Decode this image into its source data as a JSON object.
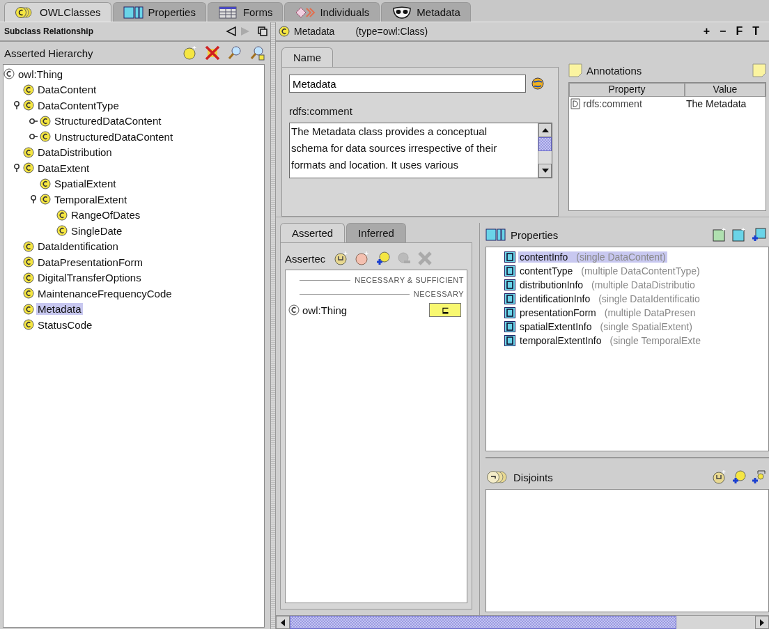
{
  "tabs": [
    {
      "label": "OWLClasses",
      "kind": "class",
      "selected": true
    },
    {
      "label": "Properties",
      "kind": "property",
      "selected": false
    },
    {
      "label": "Forms",
      "kind": "form",
      "selected": false
    },
    {
      "label": "Individuals",
      "kind": "individual",
      "selected": false
    },
    {
      "label": "Metadata",
      "kind": "metadata",
      "selected": false
    }
  ],
  "left": {
    "header": "Subclass Relationship",
    "title": "Asserted Hierarchy",
    "tree": [
      {
        "label": "owl:Thing",
        "selected": false,
        "children": [
          {
            "label": "DataContent",
            "selected": false
          },
          {
            "label": "DataContentType",
            "selected": false,
            "expanded": true,
            "children": [
              {
                "label": "StructuredDataContent",
                "selected": false,
                "expanded": false
              },
              {
                "label": "UnstructuredDataContent",
                "selected": false,
                "expanded": false
              }
            ]
          },
          {
            "label": "DataDistribution",
            "selected": false
          },
          {
            "label": "DataExtent",
            "selected": false,
            "expanded": true,
            "children": [
              {
                "label": "SpatialExtent",
                "selected": false
              },
              {
                "label": "TemporalExtent",
                "selected": false,
                "expanded": true,
                "children": [
                  {
                    "label": "RangeOfDates",
                    "selected": false
                  },
                  {
                    "label": "SingleDate",
                    "selected": false
                  }
                ]
              }
            ]
          },
          {
            "label": "DataIdentification",
            "selected": false
          },
          {
            "label": "DataPresentationForm",
            "selected": false
          },
          {
            "label": "DigitalTransferOptions",
            "selected": false
          },
          {
            "label": "MaintenanceFrequencyCode",
            "selected": false
          },
          {
            "label": "Metadata",
            "selected": true
          },
          {
            "label": "StatusCode",
            "selected": false
          }
        ]
      }
    ]
  },
  "class_header": {
    "name": "Metadata",
    "type": "(type=owl:Class)",
    "actions": [
      "+",
      "−",
      "F",
      "T"
    ]
  },
  "name_panel": {
    "tab": "Name",
    "value": "Metadata",
    "comment_label": "rdfs:comment",
    "comment": "The Metadata class provides a conceptual schema for data sources irrespective of their formats and location. It uses various"
  },
  "annotations": {
    "title": "Annotations",
    "columns": [
      "Property",
      "Value"
    ],
    "rows": [
      {
        "property": "rdfs:comment",
        "value": "The Metadata"
      }
    ]
  },
  "conditions": {
    "tabs": [
      {
        "label": "Asserted",
        "selected": true
      },
      {
        "label": "Inferred",
        "selected": false
      }
    ],
    "title": "Assertec",
    "sections": [
      "NECESSARY & SUFFICIENT",
      "NECESSARY"
    ],
    "rows": [
      {
        "label": "owl:Thing",
        "marker": "⊑"
      }
    ]
  },
  "properties": {
    "title": "Properties",
    "items": [
      {
        "name": "contentInfo",
        "detail": "(single DataContent)",
        "selected": true
      },
      {
        "name": "contentType",
        "detail": "(multiple DataContentType)",
        "selected": false
      },
      {
        "name": "distributionInfo",
        "detail": "(multiple DataDistributio",
        "selected": false
      },
      {
        "name": "identificationInfo",
        "detail": "(single DataIdentificatio",
        "selected": false
      },
      {
        "name": "presentationForm",
        "detail": "(multiple DataPresen",
        "selected": false
      },
      {
        "name": "spatialExtentInfo",
        "detail": "(single SpatialExtent)",
        "selected": false
      },
      {
        "name": "temporalExtentInfo",
        "detail": "(single TemporalExte",
        "selected": false
      }
    ]
  },
  "disjoints": {
    "title": "Disjoints"
  }
}
